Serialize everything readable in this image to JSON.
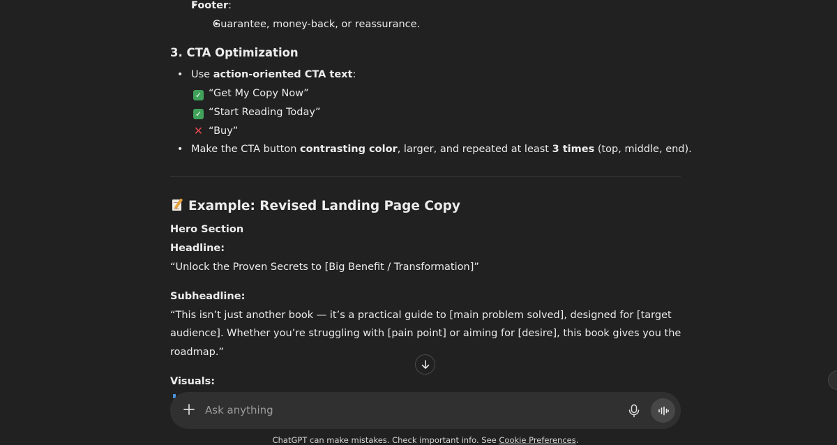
{
  "message": {
    "footer_label": "Footer",
    "footer_colon": ":",
    "footer_item": "Guarantee, money-back, or reassurance.",
    "cta_heading": "3. CTA Optimization",
    "cta_use_prefix": "Use ",
    "cta_use_bold": "action-oriented CTA text",
    "cta_use_suffix": ":",
    "examples": [
      {
        "icon": "check-mark-icon",
        "text": "“Get My Copy Now”"
      },
      {
        "icon": "check-mark-icon",
        "text": "“Start Reading Today”"
      },
      {
        "icon": "cross-mark-icon",
        "text": "“Buy”"
      }
    ],
    "cta_button_1": "Make the CTA button ",
    "cta_button_2": "contrasting color",
    "cta_button_3": ", larger, and repeated at least ",
    "cta_button_4": "3 times",
    "cta_button_5": " (top, middle, end).",
    "example_heading": "Example: Revised Landing Page Copy",
    "hero_section": "Hero Section",
    "headline_label": "Headline:",
    "headline_text": "“Unlock the Proven Secrets to [Big Benefit / Transformation]”",
    "subheadline_label": "Subheadline:",
    "subheadline_line1": "“This isn’t just another book — it’s a practical guide to [main problem solved], designed for [target",
    "subheadline_line2": "audience]. Whether you’re struggling with [pain point] or aiming for [desire], this book gives you the",
    "subheadline_line3": "roadmap.”",
    "visuals_label": "Visuals:"
  },
  "composer": {
    "placeholder": "Ask anything"
  },
  "footer": {
    "text": "ChatGPT can make mistakes. Check important info. See ",
    "link": "Cookie Preferences",
    "end": "."
  }
}
